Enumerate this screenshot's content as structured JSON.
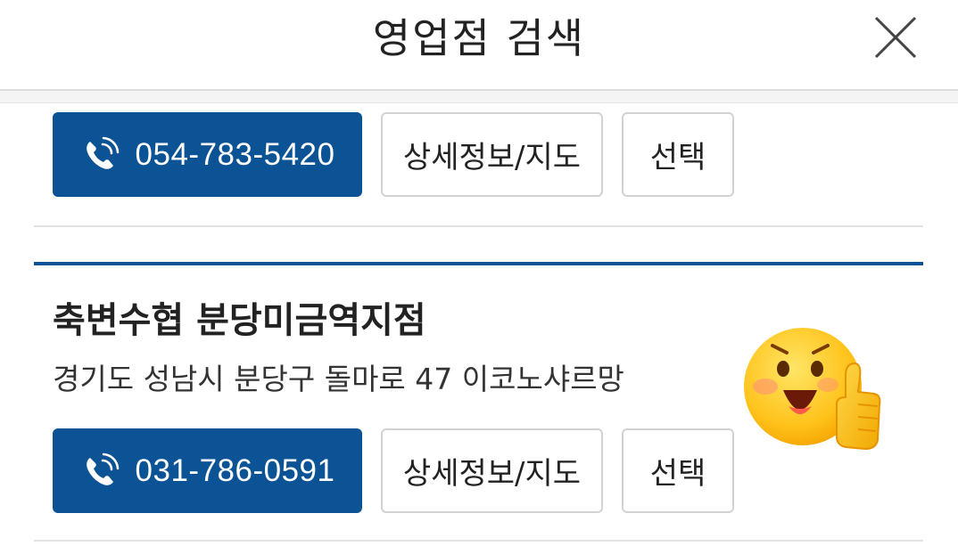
{
  "header": {
    "title": "영업점 검색",
    "close_icon": "close-icon"
  },
  "branches": [
    {
      "phone": "054-783-5420",
      "detail_label": "상세정보/지도",
      "select_label": "선택"
    },
    {
      "name": "축변수협 분당미금역지점",
      "address": "경기도 성남시 분당구 돌마로 47 이코노샤르망",
      "phone": "031-786-0591",
      "detail_label": "상세정보/지도",
      "select_label": "선택"
    }
  ],
  "sticker": "thumbs-up-emoji",
  "colors": {
    "accent": "#0b5394",
    "border": "#d2d2d2",
    "divider": "#e3e3e3"
  }
}
